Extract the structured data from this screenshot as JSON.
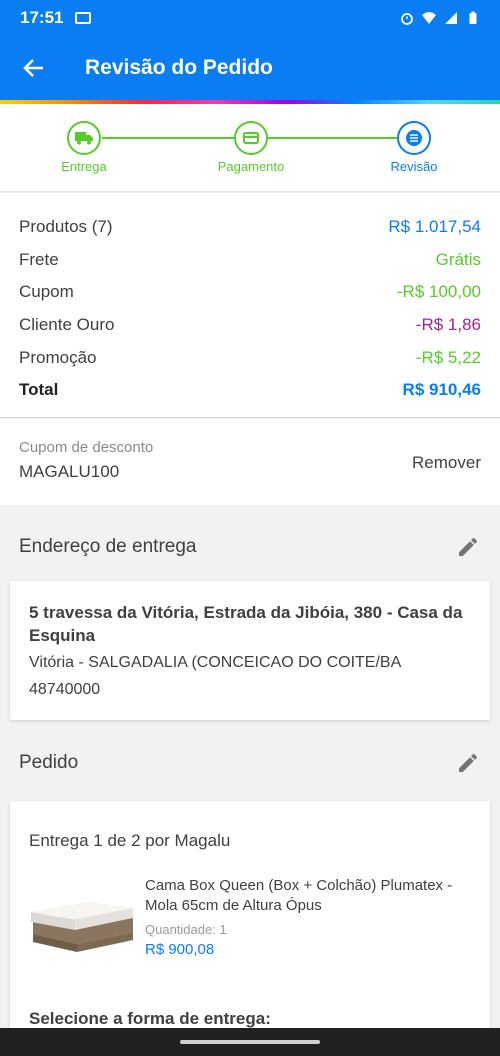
{
  "status_bar": {
    "time": "17:51"
  },
  "app_bar": {
    "title": "Revisão do Pedido"
  },
  "stepper": {
    "steps": [
      {
        "label": "Entrega",
        "icon": "truck-icon"
      },
      {
        "label": "Pagamento",
        "icon": "card-icon"
      },
      {
        "label": "Revisão",
        "icon": "list-icon"
      }
    ],
    "colors": {
      "done": "#56cc2a",
      "active": "#0a7df2"
    }
  },
  "summary": {
    "rows": [
      {
        "label": "Produtos (7)",
        "value": "R$ 1.017,54",
        "color": "#0a7df2"
      },
      {
        "label": "Frete",
        "value": "Grátis",
        "color": "#56cc2a"
      },
      {
        "label": "Cupom",
        "value": "-R$ 100,00",
        "color": "#56cc2a"
      },
      {
        "label": "Cliente Ouro",
        "value": "-R$ 1,86",
        "color": "#a4248c"
      },
      {
        "label": "Promoção",
        "value": "-R$ 5,22",
        "color": "#56cc2a"
      }
    ],
    "total": {
      "label": "Total",
      "value": "R$ 910,46",
      "color": "#0a7df2"
    }
  },
  "coupon": {
    "label": "Cupom de desconto",
    "code": "MAGALU100",
    "remove_label": "Remover"
  },
  "address_section": {
    "title": "Endereço de entrega",
    "line1": "5 travessa da Vitória, Estrada da Jibóia, 380 - Casa da Esquina",
    "line2": "Vitória - SALGADALIA (CONCEICAO DO COITE/BA",
    "line3": "48740000"
  },
  "order_section": {
    "title": "Pedido",
    "shipment_title": "Entrega 1 de 2 por Magalu",
    "product": {
      "name": "Cama Box Queen (Box + Colchão) Plumatex - Mola 65cm de Altura Ópus",
      "quantity": "Quantidade:  1",
      "price": "R$ 900,08"
    },
    "select_shipping": "Selecione a forma de entrega:"
  }
}
